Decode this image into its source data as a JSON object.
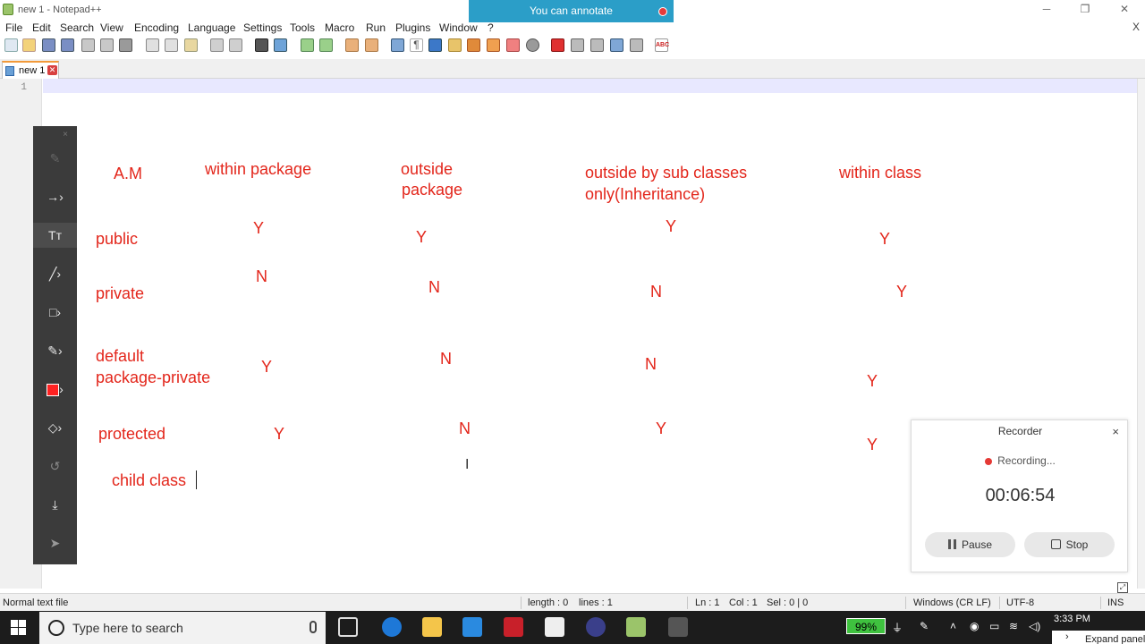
{
  "window": {
    "title": "new 1 - Notepad++",
    "controls": {
      "minimize": "─",
      "restore": "❐",
      "close": "✕"
    }
  },
  "annotate_banner": {
    "text": "You can annotate"
  },
  "menu": {
    "items": [
      "File",
      "Edit",
      "Search",
      "View",
      "Encoding",
      "Language",
      "Settings",
      "Tools",
      "Macro",
      "Run",
      "Plugins",
      "Window",
      "?"
    ],
    "close_doc": "X"
  },
  "tabs": [
    {
      "label": "new 1",
      "active": true
    }
  ],
  "editor": {
    "line_numbers": [
      "1"
    ]
  },
  "annotation_tools": {
    "close": "×",
    "tools": [
      "pen-icon",
      "arrow-icon",
      "text-icon",
      "line-icon",
      "rectangle-icon",
      "highlighter-icon",
      "color-icon",
      "eraser-icon",
      "undo-icon",
      "save-icon",
      "pointer-icon"
    ],
    "active_tool": "text-icon",
    "color": "#f22222"
  },
  "annotations": {
    "headers": {
      "am": "A.M",
      "within_package": "within package",
      "outside_package_1": "outside",
      "outside_package_2": "package",
      "sub_classes_1": "outside by sub classes",
      "sub_classes_2": "only(Inheritance)",
      "within_class": "within class"
    },
    "rows": {
      "public": {
        "label": "public",
        "within_package": "Y",
        "outside_package": "Y",
        "sub_classes": "Y",
        "within_class": "Y"
      },
      "private": {
        "label": "private",
        "within_package": "N",
        "outside_package": "N",
        "sub_classes": "N",
        "within_class": "Y"
      },
      "default": {
        "label_1": "default",
        "label_2": "package-private",
        "within_package": "Y",
        "outside_package": "N",
        "sub_classes": "N",
        "within_class": "Y"
      },
      "protected": {
        "label": "protected",
        "within_package": "Y",
        "outside_package": "N",
        "sub_classes": "Y",
        "within_class": "Y"
      }
    },
    "typing": "child class",
    "color": "#e3261b"
  },
  "recorder": {
    "title": "Recorder",
    "close": "×",
    "status": "Recording...",
    "time": "00:06:54",
    "pause_label": "Pause",
    "stop_label": "Stop"
  },
  "statusbar": {
    "file_type": "Normal text file",
    "length": "length : 0",
    "lines": "lines : 1",
    "ln": "Ln : 1",
    "col": "Col : 1",
    "sel": "Sel : 0 | 0",
    "eol": "Windows (CR LF)",
    "encoding": "UTF-8",
    "mode": "INS"
  },
  "taskbar": {
    "search_placeholder": "Type here to search",
    "battery": "99%",
    "time": "3:33 PM",
    "expand_panel": "Expand panel",
    "expand_chevron": "›"
  }
}
